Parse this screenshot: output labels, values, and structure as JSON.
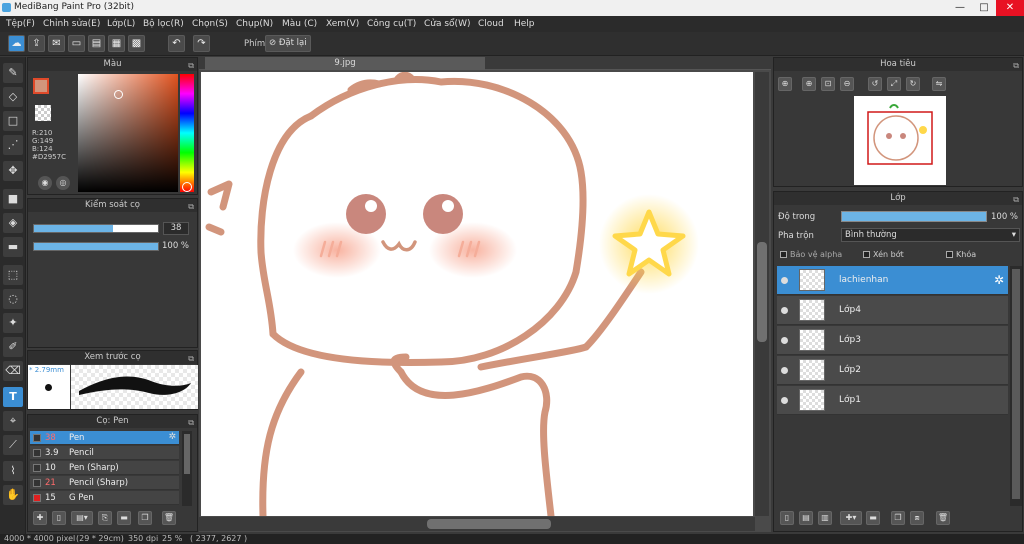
{
  "window": {
    "title": "MediBang Paint Pro (32bit)",
    "min": "—",
    "max": "□",
    "close": "✕"
  },
  "menu": [
    "Tệp(F)",
    "Chỉnh sửa(E)",
    "Lớp(L)",
    "Bộ lọc(R)",
    "Chọn(S)",
    "Chụp(N)",
    "Màu (C)",
    "Xem(V)",
    "Công cụ(T)",
    "Cửa sổ(W)",
    "Cloud",
    "Help"
  ],
  "toolbar": {
    "phim_label": "Phím",
    "reset_label": "Đặt lại"
  },
  "color_panel": {
    "title": "Màu",
    "r": "R:210",
    "g": "G:149",
    "b": "B:124",
    "hex": "#D2957C",
    "fg_color": "#D2957C"
  },
  "brush_control": {
    "title": "Kiểm soát cọ",
    "size": "38",
    "opacity": "100 %",
    "size_fraction": 0.64,
    "opacity_fraction": 1.0
  },
  "brush_preview": {
    "title": "Xem trước cọ",
    "size_label": "* 2.79mm"
  },
  "brush_panel": {
    "title": "Cọ: Pen",
    "items": [
      {
        "size": "38",
        "name": "Pen",
        "selected": true,
        "size_color": "#ff6b6b"
      },
      {
        "size": "3.9",
        "name": "Pencil",
        "selected": false,
        "size_color": "#eeeeee"
      },
      {
        "size": "10",
        "name": "Pen (Sharp)",
        "selected": false,
        "size_color": "#eeeeee"
      },
      {
        "size": "21",
        "name": "Pencil (Sharp)",
        "selected": false,
        "size_color": "#ff6b6b"
      },
      {
        "size": "15",
        "name": "G Pen",
        "selected": false,
        "size_color": "#eeeeee"
      }
    ]
  },
  "document": {
    "tab": "9.jpg"
  },
  "navigator": {
    "title": "Hoa tiêu"
  },
  "layer_panel": {
    "title": "Lớp",
    "opacity_label": "Độ trong",
    "opacity_value": "100 %",
    "blend_label": "Pha trộn",
    "blend_value": "Bình thường",
    "protect_alpha": "Bảo vệ alpha",
    "clipping": "Xén bớt",
    "lock": "Khóa",
    "layers": [
      {
        "name": "lachienhan",
        "selected": true
      },
      {
        "name": "Lớp4",
        "selected": false
      },
      {
        "name": "Lớp3",
        "selected": false
      },
      {
        "name": "Lớp2",
        "selected": false
      },
      {
        "name": "Lớp1",
        "selected": false
      }
    ]
  },
  "status": {
    "size": "4000 * 4000 pixel",
    "cm": "(29 * 29cm)",
    "dpi": "350 dpi",
    "zoom": "25 %",
    "coords": "( 2377, 2627 )"
  }
}
